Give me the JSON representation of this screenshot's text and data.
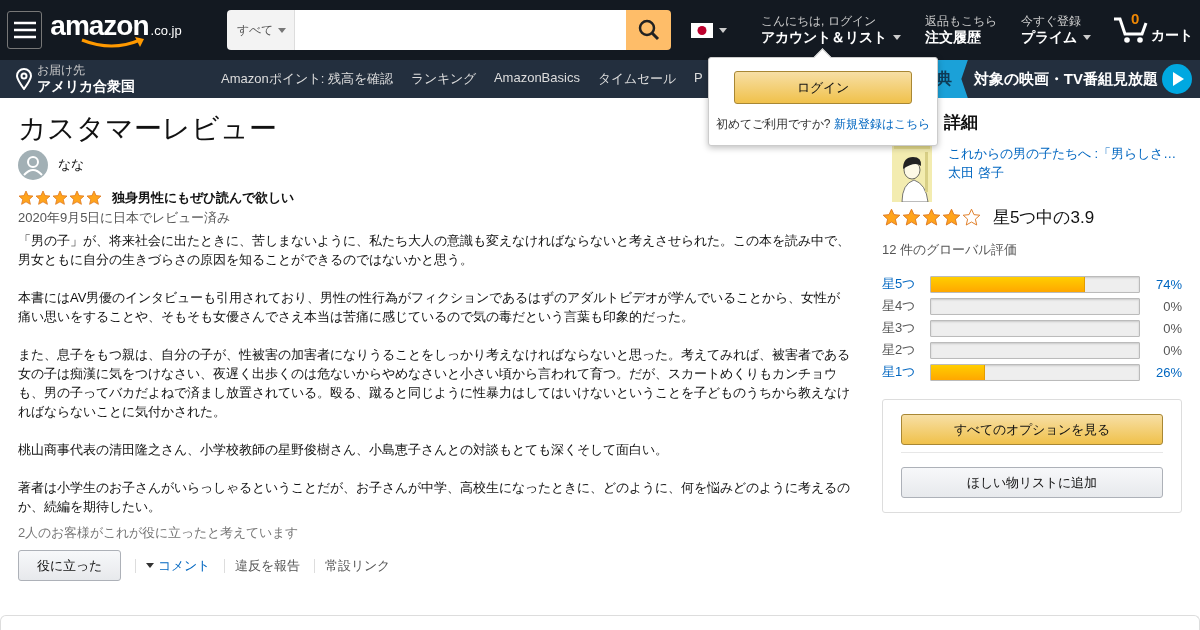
{
  "header": {
    "logo": "amazon",
    "logo_suffix": ".co.jp",
    "search": {
      "category": "すべて"
    },
    "account_greeting": "こんにちは, ログイン",
    "account_label": "アカウント＆リスト",
    "orders_top": "返品もこちら",
    "orders_label": "注文履歴",
    "prime_top": "今すぐ登録",
    "prime_label": "プライム",
    "cart_count": "0",
    "cart_label": "カート"
  },
  "nav": {
    "deliver_to_top": "お届け先",
    "deliver_to": "アメリカ合衆国",
    "links": [
      "Amazonポイント: 残高を確認",
      "ランキング",
      "AmazonBasics",
      "タイムセール",
      "P"
    ],
    "promo_badge": "典",
    "promo_text": "対象の映画・TV番組見放題"
  },
  "login_popup": {
    "button": "ログイン",
    "question": "初めてご利用ですか?",
    "signup_link": "新規登録はこちら"
  },
  "review": {
    "title": "カスタマーレビュー",
    "reviewer": "なな",
    "stars": 5,
    "headline": "独身男性にもぜひ読んで欲しい",
    "date": "2020年9月5日に日本でレビュー済み",
    "paragraphs": [
      "「男の子」が、将来社会に出たときに、苦しまないように、私たち大人の意識も変えなければならないと考えさせられた。この本を読み中で、男女ともに自分の生きづらさの原因を知ることができるのではないかと思う。",
      "本書にはAV男優のインタビューも引用されており、男性の性行為がフィクションであるはずのアダルトビデオが学んでいることから、女性が痛い思いをすることや、そもそも女優さんでさえ本当は苦痛に感じているので気の毒だという言葉も印象的だった。",
      "また、息子をもつ親は、自分の子が、性被害の加害者になりうることをしっかり考えなければならないと思った。考えてみれば、被害者である女の子は痴漢に気をつけなさい、夜遅く出歩くのは危ないからやめなさいと小さい頃から言われて育つ。だが、スカートめくりもカンチョウも、男の子ってバカだよねで済まし放置されている。殴る、蹴ると同じように性暴力はしてはいけないということを子どものうちから教えなければならないことに気付かされた。",
      "桃山商事代表の清田隆之さん、小学校教師の星野俊樹さん、小島恵子さんとの対談もとても深くそして面白い。",
      "著者は小学生のお子さんがいらっしゃるということだが、お子さんが中学、高校生になったときに、どのように、何を悩みどのように考えるのか、続編を期待したい。"
    ],
    "helpful_count": "2人のお客様がこれが役に立ったと考えています",
    "helpful_button": "役に立った",
    "comment_link": "コメント",
    "report_link": "違反を報告",
    "permalink": "常設リンク"
  },
  "details": {
    "heading": "詳細",
    "product_title": "これからの男の子たちへ :「男らしさ…",
    "author": "太田 啓子",
    "stars": 4,
    "rating_text": "星5つ中の3.9",
    "global_ratings": "12 件のグローバル評価",
    "histogram": [
      {
        "label": "星5つ",
        "level": 0.74,
        "percent": "74%",
        "linked": true
      },
      {
        "label": "星4つ",
        "level": 0,
        "percent": "0%",
        "linked": false
      },
      {
        "label": "星3つ",
        "level": 0,
        "percent": "0%",
        "linked": false
      },
      {
        "label": "星2つ",
        "level": 0,
        "percent": "0%",
        "linked": false
      },
      {
        "label": "星1つ",
        "level": 0.26,
        "percent": "26%",
        "linked": true
      }
    ],
    "buttons": [
      {
        "label": "すべてのオプションを見る",
        "kind": "primary"
      },
      {
        "label": "ほしい物リストに追加",
        "kind": "secondary"
      }
    ]
  }
}
